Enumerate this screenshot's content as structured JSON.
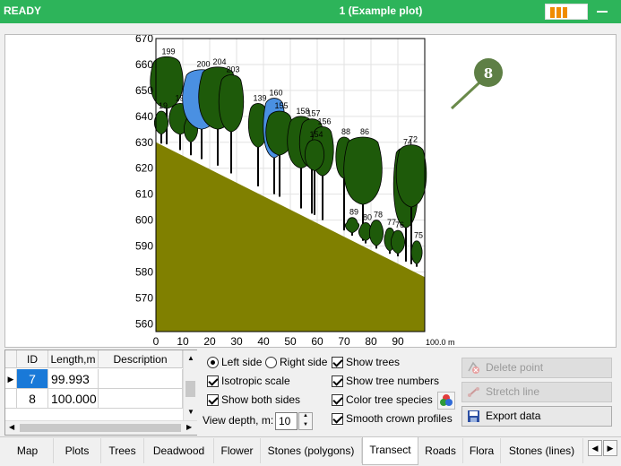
{
  "titlebar": {
    "status": "READY",
    "plot_title": "1 (Example plot)",
    "accent_color": "#2db45a"
  },
  "chart_data": {
    "type": "transect",
    "ylabel_unit": "",
    "x_end_label": "100.0 m",
    "x_ticks": [
      "0",
      "10",
      "20",
      "30",
      "40",
      "50",
      "60",
      "70",
      "80",
      "90"
    ],
    "y_ticks": [
      "670",
      "660",
      "650",
      "640",
      "630",
      "620",
      "610",
      "600",
      "590",
      "580",
      "570",
      "560"
    ],
    "xlim": [
      0,
      100
    ],
    "ylim": [
      557,
      670
    ],
    "ground": {
      "x": [
        0,
        100
      ],
      "y": [
        630,
        578
      ],
      "color": "#808000"
    },
    "compass_label": "8",
    "trees": [
      {
        "id": "199",
        "x": 4,
        "base": 629.2,
        "top": 663,
        "w": 6,
        "cb": 643,
        "species": "deciduous"
      },
      {
        "id": "194",
        "x": 9,
        "base": 627,
        "top": 645,
        "w": 4,
        "cb": 633,
        "species": "deciduous"
      },
      {
        "id": "19",
        "x": 2,
        "base": 629.5,
        "top": 642,
        "w": 2.5,
        "cb": 633,
        "species": "deciduous"
      },
      {
        "id": "40",
        "x": 13,
        "base": 625,
        "top": 640,
        "w": 2.5,
        "cb": 630,
        "species": "deciduous"
      },
      {
        "id": "200",
        "x": 17,
        "base": 623.5,
        "top": 658,
        "w": 7,
        "cb": 635,
        "species": "conifer"
      },
      {
        "id": "204",
        "x": 23,
        "base": 621,
        "top": 659,
        "w": 7,
        "cb": 635,
        "species": "deciduous"
      },
      {
        "id": "203",
        "x": 28,
        "base": 618,
        "top": 656,
        "w": 4.5,
        "cb": 634,
        "species": "deciduous"
      },
      {
        "id": "139",
        "x": 38,
        "base": 613,
        "top": 645,
        "w": 3.5,
        "cb": 628,
        "species": "deciduous"
      },
      {
        "id": "160",
        "x": 44,
        "base": 610,
        "top": 647,
        "w": 4,
        "cb": 624,
        "species": "conifer"
      },
      {
        "id": "155",
        "x": 46,
        "base": 609,
        "top": 642,
        "w": 5,
        "cb": 625,
        "species": "deciduous"
      },
      {
        "id": "158",
        "x": 54,
        "base": 604.5,
        "top": 640,
        "w": 5,
        "cb": 620,
        "species": "deciduous"
      },
      {
        "id": "157",
        "x": 58,
        "base": 602.5,
        "top": 639,
        "w": 4.5,
        "cb": 620,
        "species": "deciduous"
      },
      {
        "id": "156",
        "x": 62,
        "base": 600,
        "top": 636,
        "w": 4,
        "cb": 617,
        "species": "deciduous"
      },
      {
        "id": "154",
        "x": 59,
        "base": 602,
        "top": 631,
        "w": 3.5,
        "cb": 619,
        "species": "deciduous"
      },
      {
        "id": "88",
        "x": 70,
        "base": 596,
        "top": 632,
        "w": 3,
        "cb": 616,
        "species": "deciduous"
      },
      {
        "id": "86",
        "x": 77,
        "base": 592,
        "top": 632,
        "w": 7,
        "cb": 606,
        "species": "deciduous"
      },
      {
        "id": "74",
        "x": 93,
        "base": 584,
        "top": 628,
        "w": 4.5,
        "cb": 597,
        "species": "deciduous"
      },
      {
        "id": "72",
        "x": 95,
        "base": 583,
        "top": 629,
        "w": 5.5,
        "cb": 605,
        "species": "deciduous"
      },
      {
        "id": "89",
        "x": 73,
        "base": 594,
        "top": 601,
        "w": 2.5,
        "cb": 595,
        "species": "deciduous"
      },
      {
        "id": "80",
        "x": 78,
        "base": 591,
        "top": 599,
        "w": 2.5,
        "cb": 592,
        "species": "deciduous"
      },
      {
        "id": "78",
        "x": 82,
        "base": 589,
        "top": 600,
        "w": 2.5,
        "cb": 590,
        "species": "deciduous"
      },
      {
        "id": "77",
        "x": 87,
        "base": 587,
        "top": 597,
        "w": 2,
        "cb": 588,
        "species": "deciduous"
      },
      {
        "id": "76",
        "x": 90,
        "base": 586,
        "top": 596,
        "w": 2.5,
        "cb": 587,
        "species": "deciduous"
      },
      {
        "id": "75",
        "x": 97,
        "base": 582,
        "top": 592,
        "w": 2,
        "cb": 583,
        "species": "deciduous"
      }
    ],
    "species_colors": {
      "deciduous": "#1e5a0a",
      "conifer": "#4a90e2"
    }
  },
  "grid": {
    "columns": [
      "ID",
      "Length,m",
      "Description"
    ],
    "rows": [
      {
        "id": "7",
        "length": "99.993",
        "description": ""
      },
      {
        "id": "8",
        "length": "100.000",
        "description": ""
      }
    ]
  },
  "options": {
    "left_side": "Left side",
    "right_side": "Right side",
    "isotropic": "Isotropic scale",
    "both_sides": "Show both sides",
    "view_depth_label": "View depth, m:",
    "view_depth_value": "10",
    "show_trees": "Show trees",
    "show_tree_numbers": "Show tree numbers",
    "color_species": "Color tree species",
    "smooth_crown": "Smooth crown profiles"
  },
  "actions": {
    "delete_point": "Delete point",
    "stretch_line": "Stretch line",
    "export_data": "Export data"
  },
  "tabs": [
    "Map",
    "Plots",
    "Trees",
    "Deadwood",
    "Flower",
    "Stones (polygons)",
    "Transect",
    "Roads",
    "Flora",
    "Stones (lines)"
  ],
  "active_tab": "Transect"
}
